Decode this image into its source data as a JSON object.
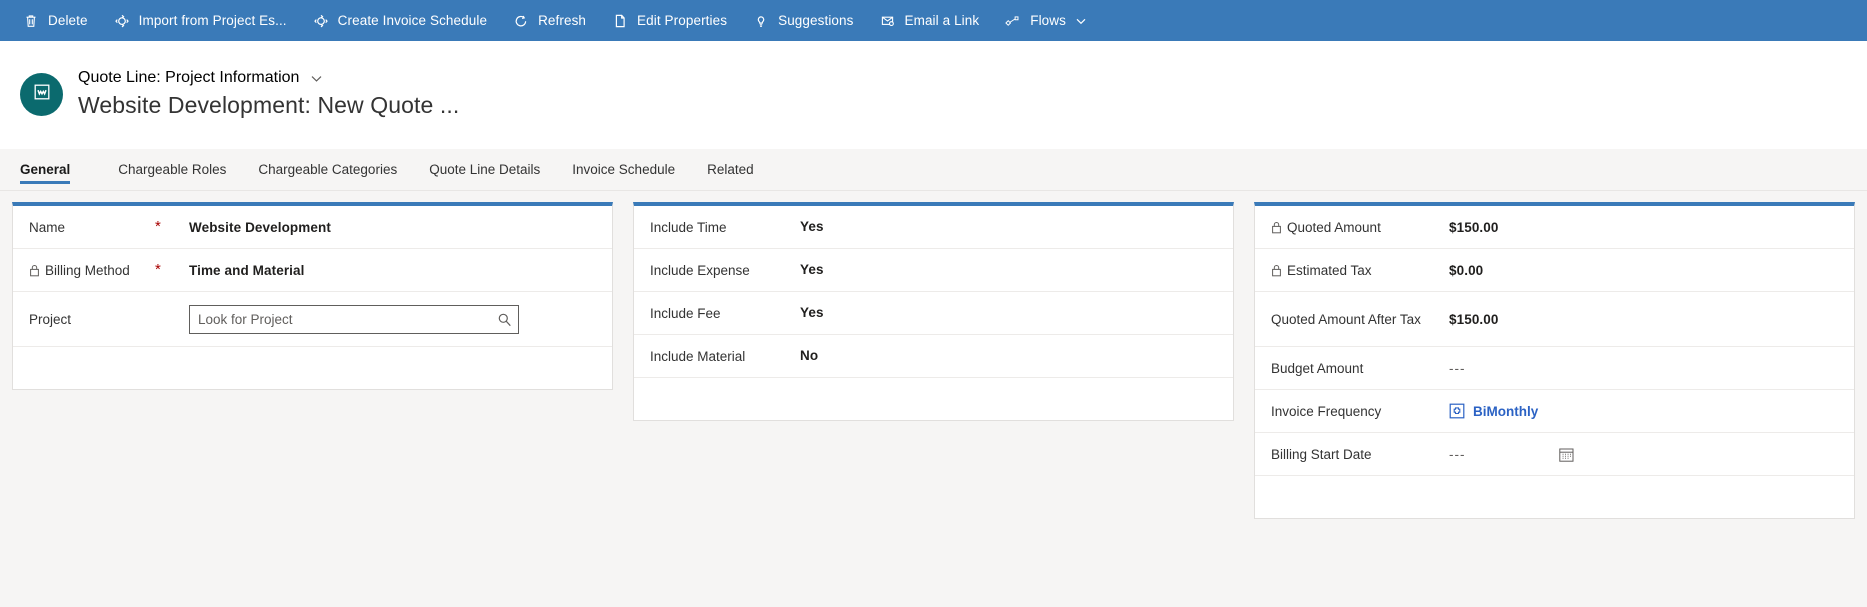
{
  "commandbar": {
    "items": [
      {
        "label": "Delete",
        "icon": "trash-icon"
      },
      {
        "label": "Import from Project Es...",
        "icon": "import-icon"
      },
      {
        "label": "Create Invoice Schedule",
        "icon": "invoice-schedule-icon"
      },
      {
        "label": "Refresh",
        "icon": "refresh-icon"
      },
      {
        "label": "Edit Properties",
        "icon": "edit-properties-icon"
      },
      {
        "label": "Suggestions",
        "icon": "lightbulb-icon"
      },
      {
        "label": "Email a Link",
        "icon": "email-link-icon"
      },
      {
        "label": "Flows",
        "icon": "flows-icon",
        "chevron": true
      }
    ],
    "background": "#3a7ab8"
  },
  "header": {
    "breadcrumb": "Quote Line: Project Information",
    "title": "Website Development: New Quote ...",
    "avatar_color": "#0b6a6e",
    "avatar_icon": "quote-line-entity-icon"
  },
  "tabs": {
    "accent": "#3a7ab8",
    "items": [
      {
        "label": "General",
        "active": true
      },
      {
        "label": "Chargeable Roles",
        "active": false
      },
      {
        "label": "Chargeable Categories",
        "active": false
      },
      {
        "label": "Quote Line Details",
        "active": false
      },
      {
        "label": "Invoice Schedule",
        "active": false
      },
      {
        "label": "Related",
        "active": false
      }
    ]
  },
  "cards": {
    "left": {
      "rows": [
        {
          "label": "Name",
          "required": true,
          "locked": false,
          "value": "Website Development",
          "type": "text"
        },
        {
          "label": "Billing Method",
          "required": true,
          "locked": true,
          "value": "Time and Material",
          "type": "text"
        },
        {
          "label": "Project",
          "required": false,
          "locked": false,
          "value": "",
          "placeholder": "Look for Project",
          "type": "lookup"
        }
      ]
    },
    "middle": {
      "rows": [
        {
          "label": "Include Time",
          "value": "Yes"
        },
        {
          "label": "Include Expense",
          "value": "Yes"
        },
        {
          "label": "Include Fee",
          "value": "Yes"
        },
        {
          "label": "Include Material",
          "value": "No"
        }
      ]
    },
    "right": {
      "rows": [
        {
          "label": "Quoted Amount",
          "locked": true,
          "value": "$150.00",
          "type": "text"
        },
        {
          "label": "Estimated Tax",
          "locked": true,
          "value": "$0.00",
          "type": "text"
        },
        {
          "label": "Quoted Amount After Tax",
          "locked": false,
          "value": "$150.00",
          "type": "text"
        },
        {
          "label": "Budget Amount",
          "locked": false,
          "value": "---",
          "type": "empty"
        },
        {
          "label": "Invoice Frequency",
          "locked": false,
          "value": "BiMonthly",
          "type": "entity-link",
          "link_color": "#2b62c4"
        },
        {
          "label": "Billing Start Date",
          "locked": false,
          "value": "---",
          "type": "date",
          "calendar_icon": "calendar-icon"
        }
      ]
    }
  }
}
